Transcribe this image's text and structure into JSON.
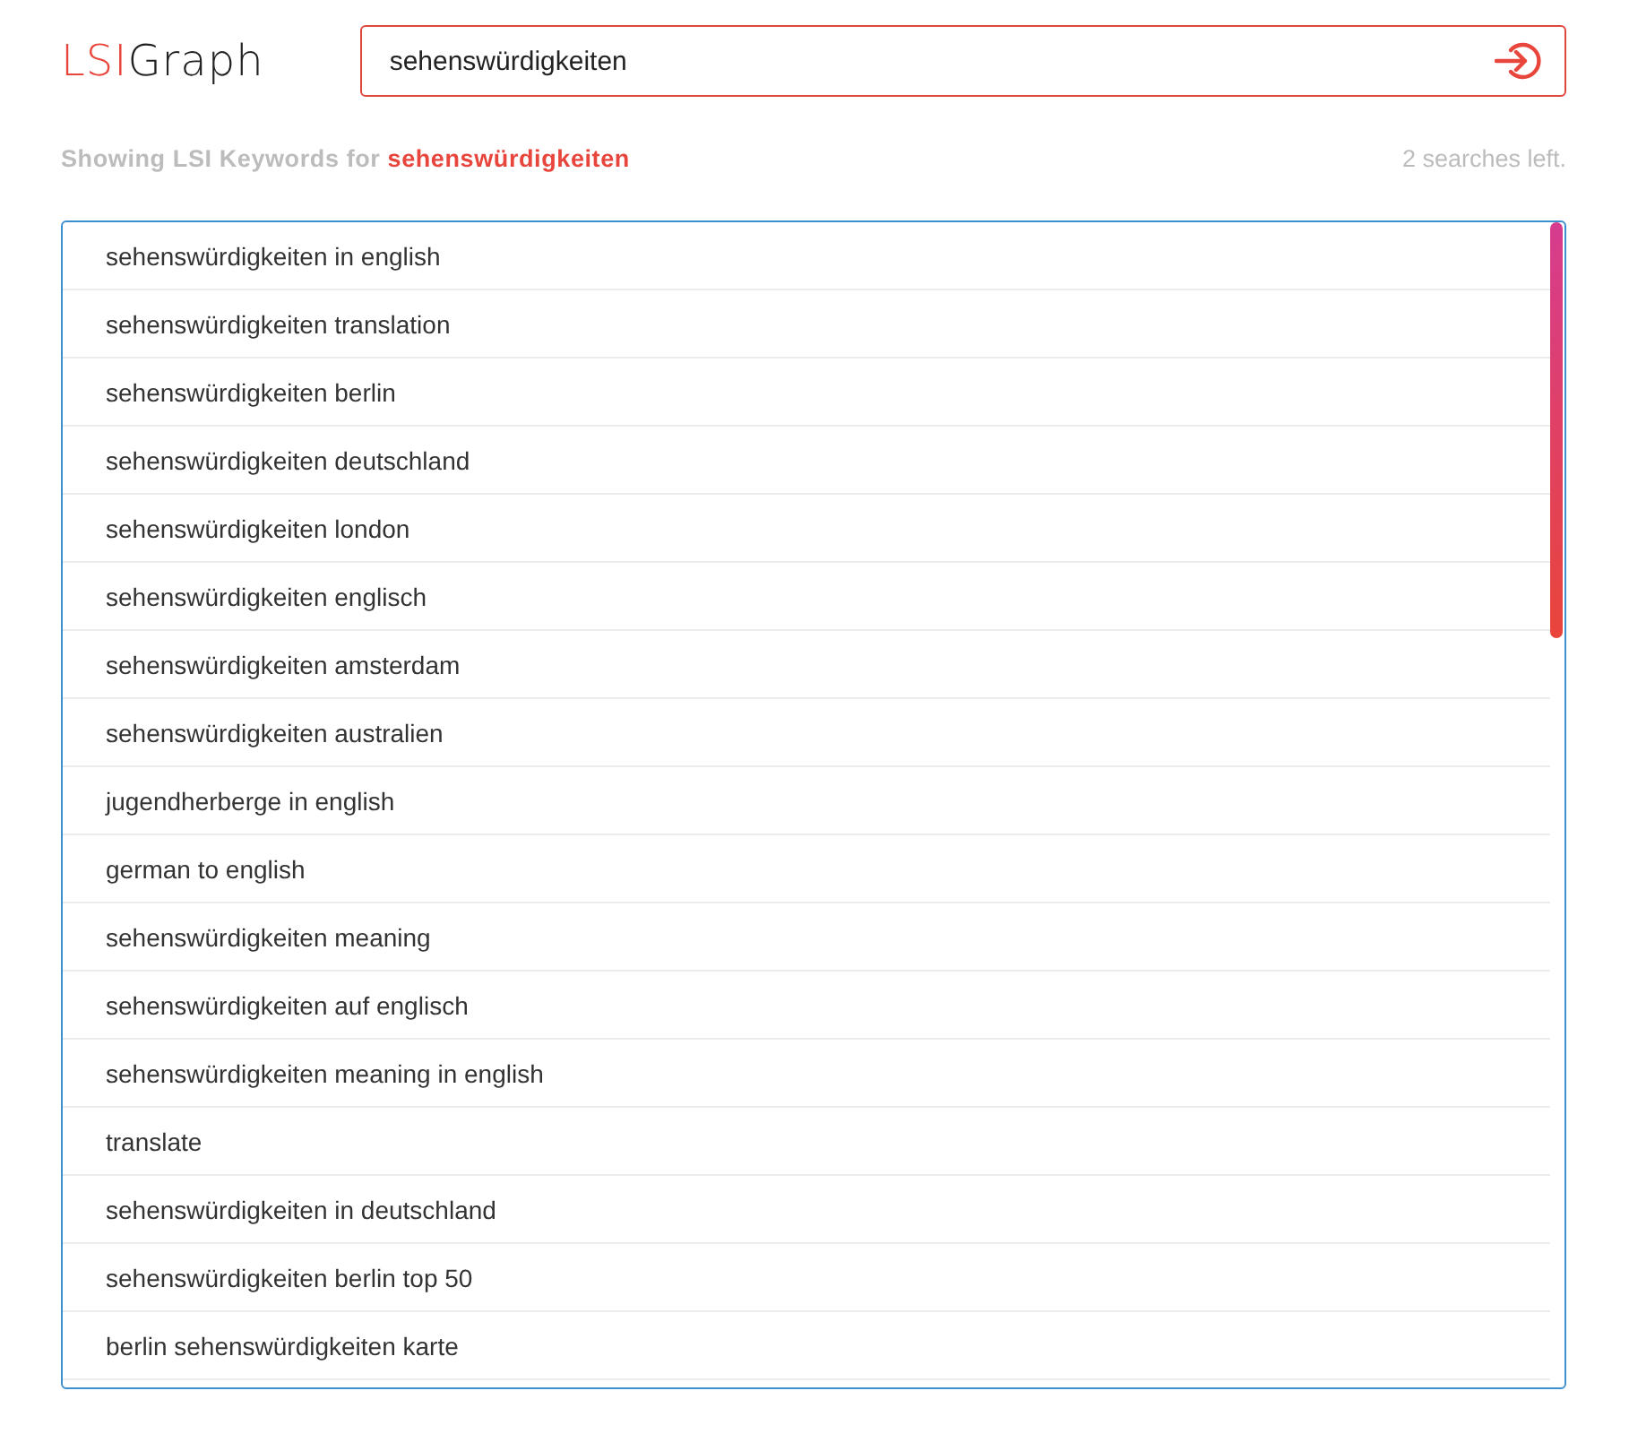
{
  "logo": {
    "part_1": "LSI",
    "part_2": "Graph"
  },
  "search": {
    "value": "sehenswürdigkeiten"
  },
  "status": {
    "prefix": "Showing LSI Keywords for",
    "term": "sehenswürdigkeiten",
    "remaining": "2 searches left."
  },
  "keywords": [
    "sehenswürdigkeiten in english",
    "sehenswürdigkeiten translation",
    "sehenswürdigkeiten berlin",
    "sehenswürdigkeiten deutschland",
    "sehenswürdigkeiten london",
    "sehenswürdigkeiten englisch",
    "sehenswürdigkeiten amsterdam",
    "sehenswürdigkeiten australien",
    "jugendherberge in english",
    "german to english",
    "sehenswürdigkeiten meaning",
    "sehenswürdigkeiten auf englisch",
    "sehenswürdigkeiten meaning in english",
    "translate",
    "sehenswürdigkeiten in deutschland",
    "sehenswürdigkeiten berlin top 50",
    "berlin sehenswürdigkeiten karte"
  ]
}
